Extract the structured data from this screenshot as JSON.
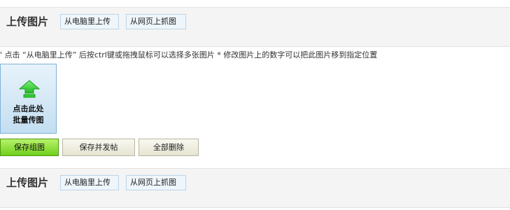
{
  "upload_panel_top": {
    "title": "上传图片",
    "from_computer_label": "从电脑里上传",
    "from_web_label": "从网页上抓图"
  },
  "hint_text": "' 点击 “从电脑里上传” 后按ctrl键或拖拽鼠标可以选择多张图片  * 修改图片上的数字可以把此图片移到指定位置",
  "batch_upload": {
    "line1": "点击此处",
    "line2": "批量传图",
    "icon": "upload-arrow-icon"
  },
  "actions": {
    "save_group": "保存组图",
    "save_and_post": "保存并发帖",
    "delete_all": "全部删除"
  },
  "upload_panel_bottom": {
    "title": "上传图片",
    "from_computer_label": "从电脑里上传",
    "from_web_label": "从网页上抓图"
  },
  "colors": {
    "save_button": "#8ee23a",
    "batch_box": "#c3def1",
    "arrow": "#2fcf2f"
  }
}
